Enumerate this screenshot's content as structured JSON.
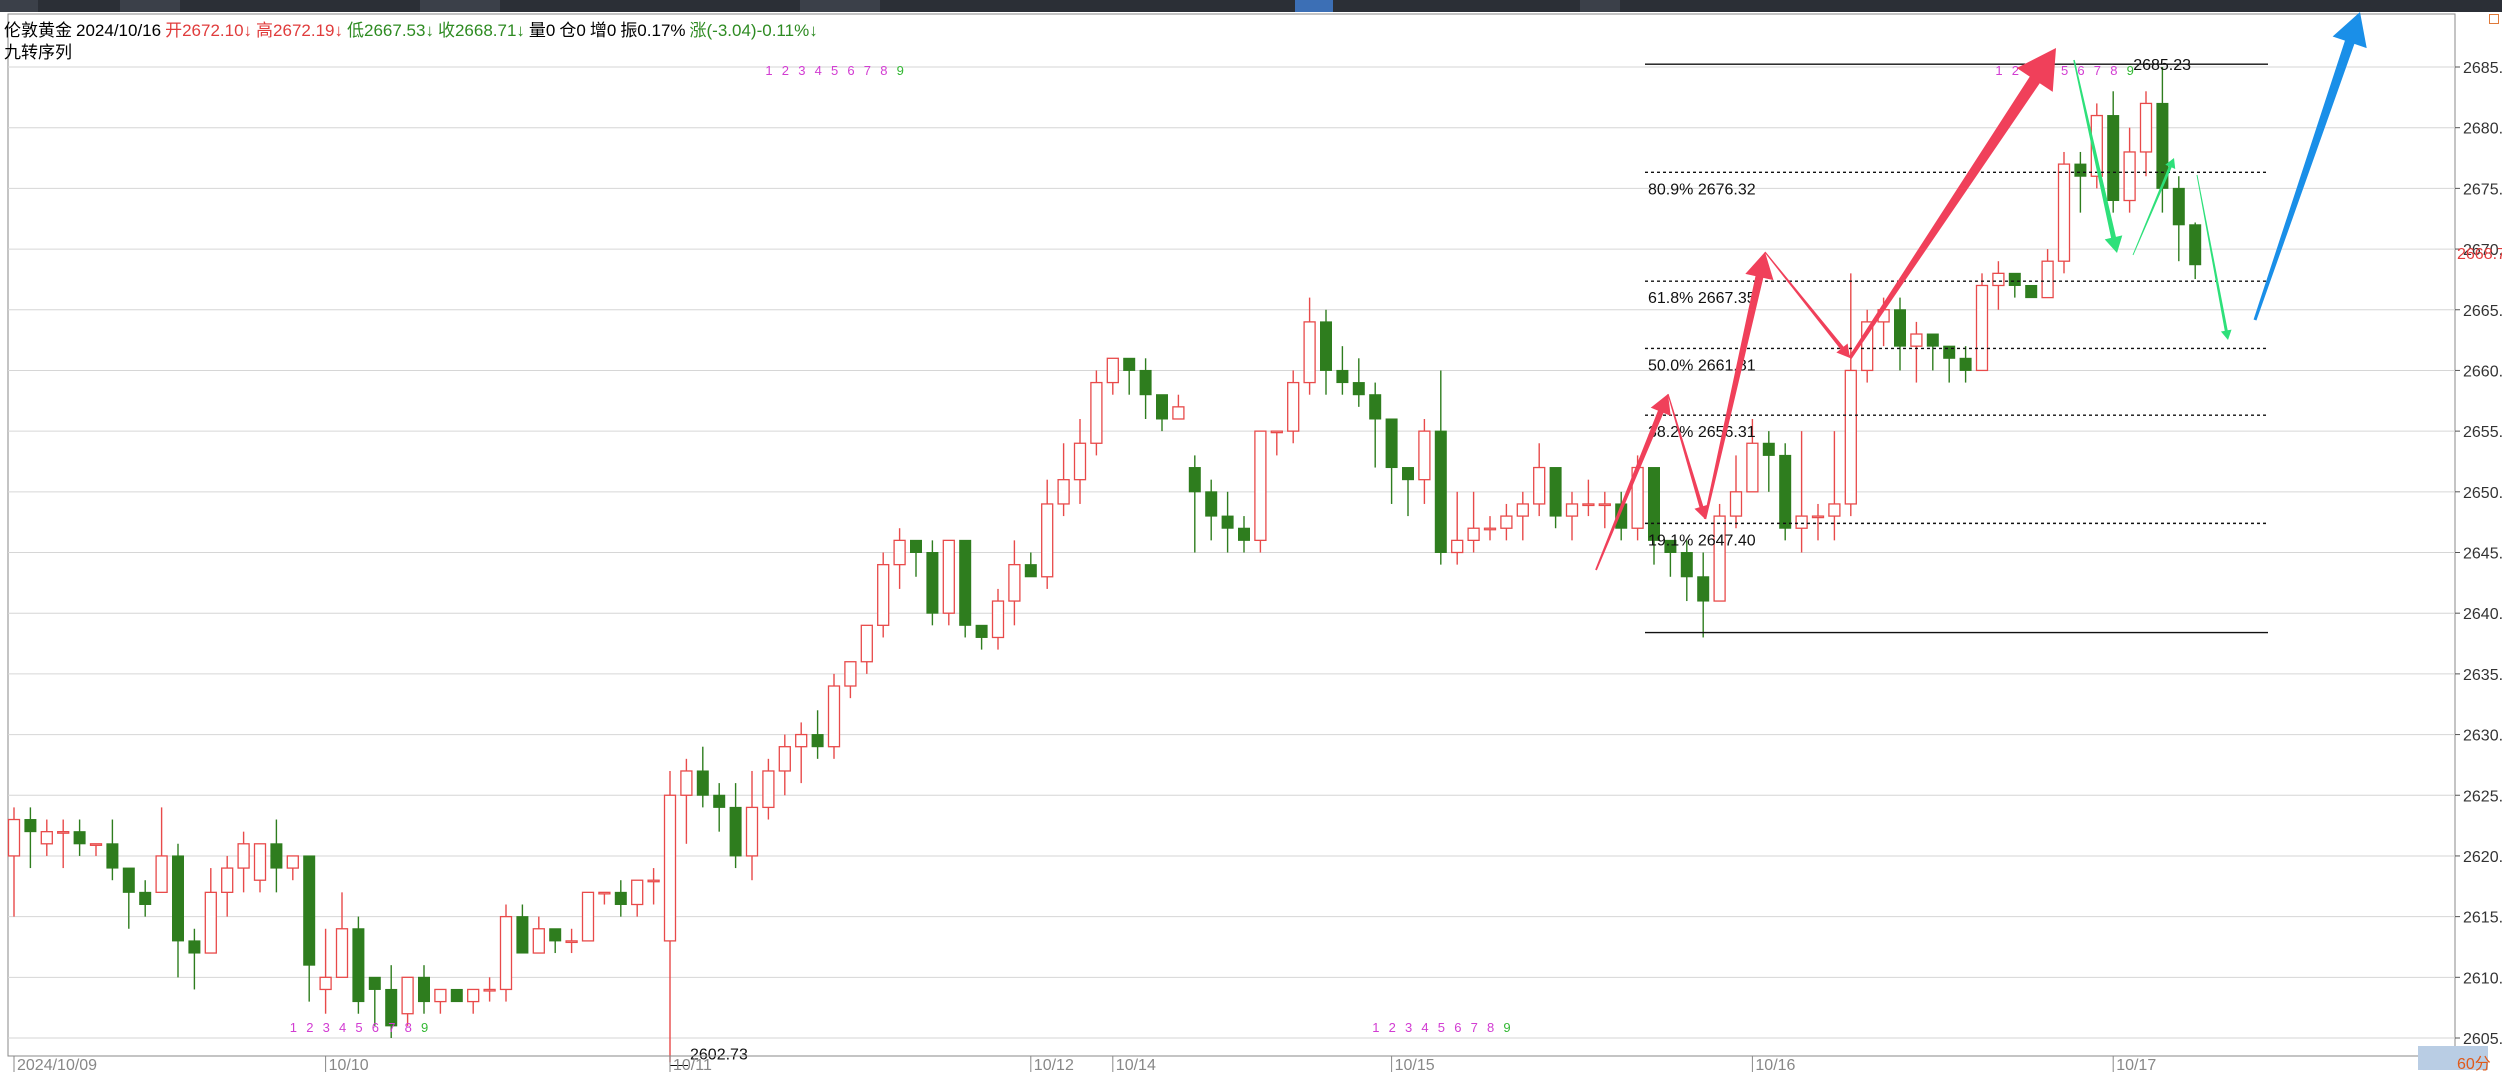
{
  "header": {
    "symbol": "伦敦黄金",
    "date": "2024/10/16",
    "open_label": "开2672.10↓",
    "high_label": "高2672.19↓",
    "low_label": "低2667.53↓",
    "close_label": "收2668.71↓",
    "volume_label": "量0",
    "position_label": "仓0",
    "increment_label": "增0",
    "amplitude_label": "振0.17%",
    "change_label": "涨(-3.04)-0.11%↓",
    "indicator_name": "九转序列"
  },
  "colors": {
    "up": "#e84a4a",
    "down": "#2e7d1e",
    "arrow_red": "#f0405a",
    "arrow_green": "#2ee07a",
    "arrow_blue": "#1a8fe8",
    "grid": "#d6d6d6",
    "magenta": "#d23cd2",
    "green_label": "#33b833",
    "price_tag": "#e03c3c"
  },
  "price_tag": "2668.7",
  "period": "60分",
  "chart_data": {
    "type": "candlestick",
    "title": "",
    "xlabel": "",
    "ylabel": "",
    "ylim": [
      2602,
      2689
    ],
    "grid": true,
    "y_ticks": [
      2605,
      2610,
      2615,
      2620,
      2625,
      2630,
      2635,
      2640,
      2645,
      2650,
      2655,
      2660,
      2665,
      2670,
      2675,
      2680,
      2685
    ],
    "y_tick_labels": [
      "2605.0",
      "2610.0",
      "2615.0",
      "2620.0",
      "2625.0",
      "2630.0",
      "2635.0",
      "2640.0",
      "2645.0",
      "2650.0",
      "2655.0",
      "2660.0",
      "2665.0",
      "2670.0",
      "2675.0",
      "2680.0",
      "2685.0"
    ],
    "x_labels": [
      {
        "index": 0,
        "label": "2024/10/09"
      },
      {
        "index": 19,
        "label": "10/10"
      },
      {
        "index": 40,
        "label": "10/11"
      },
      {
        "index": 62,
        "label": "10/12"
      },
      {
        "index": 67,
        "label": "10/14"
      },
      {
        "index": 84,
        "label": "10/15"
      },
      {
        "index": 106,
        "label": "10/16"
      },
      {
        "index": 128,
        "label": "10/17"
      }
    ],
    "candles": [
      [
        2620,
        2623,
        2615,
        2624
      ],
      [
        2623,
        2622,
        2619,
        2624
      ],
      [
        2621,
        2622,
        2620,
        2623
      ],
      [
        2622,
        2622,
        2619,
        2623
      ],
      [
        2622,
        2621,
        2620,
        2623
      ],
      [
        2621,
        2621,
        2620,
        2621
      ],
      [
        2621,
        2619,
        2618,
        2623
      ],
      [
        2619,
        2617,
        2614,
        2619
      ],
      [
        2617,
        2616,
        2615,
        2618
      ],
      [
        2617,
        2620,
        2617,
        2624
      ],
      [
        2620,
        2613,
        2610,
        2621
      ],
      [
        2613,
        2612,
        2609,
        2614
      ],
      [
        2612,
        2617,
        2612,
        2619
      ],
      [
        2617,
        2619,
        2615,
        2620
      ],
      [
        2619,
        2621,
        2617,
        2622
      ],
      [
        2618,
        2621,
        2617,
        2621
      ],
      [
        2621,
        2619,
        2617,
        2623
      ],
      [
        2619,
        2620,
        2618,
        2620
      ],
      [
        2620,
        2611,
        2608,
        2620
      ],
      [
        2609,
        2610,
        2607,
        2614
      ],
      [
        2610,
        2614,
        2610,
        2617
      ],
      [
        2614,
        2608,
        2607,
        2615
      ],
      [
        2610,
        2609,
        2606,
        2610
      ],
      [
        2609,
        2606,
        2605,
        2611
      ],
      [
        2607,
        2610,
        2606,
        2610
      ],
      [
        2610,
        2608,
        2607,
        2611
      ],
      [
        2608,
        2609,
        2607,
        2609
      ],
      [
        2609,
        2608,
        2608,
        2609
      ],
      [
        2608,
        2609,
        2607,
        2609
      ],
      [
        2609,
        2609,
        2608,
        2610
      ],
      [
        2609,
        2615,
        2608,
        2616
      ],
      [
        2615,
        2612,
        2612,
        2616
      ],
      [
        2612,
        2614,
        2612,
        2615
      ],
      [
        2614,
        2613,
        2612,
        2614
      ],
      [
        2613,
        2613,
        2612,
        2614
      ],
      [
        2613,
        2617,
        2613,
        2617
      ],
      [
        2617,
        2617,
        2616,
        2617
      ],
      [
        2617,
        2616,
        2615,
        2618
      ],
      [
        2616,
        2618,
        2615,
        2618
      ],
      [
        2618,
        2618,
        2616,
        2619
      ],
      [
        2613,
        2625,
        2603,
        2627
      ],
      [
        2625,
        2627,
        2621,
        2628
      ],
      [
        2627,
        2625,
        2624,
        2629
      ],
      [
        2625,
        2624,
        2622,
        2626
      ],
      [
        2624,
        2620,
        2619,
        2626
      ],
      [
        2620,
        2624,
        2618,
        2627
      ],
      [
        2624,
        2627,
        2623,
        2628
      ],
      [
        2627,
        2629,
        2625,
        2630
      ],
      [
        2629,
        2630,
        2626,
        2631
      ],
      [
        2630,
        2629,
        2628,
        2632
      ],
      [
        2629,
        2634,
        2628,
        2635
      ],
      [
        2634,
        2636,
        2633,
        2636
      ],
      [
        2636,
        2639,
        2635,
        2639
      ],
      [
        2639,
        2644,
        2638,
        2645
      ],
      [
        2644,
        2646,
        2642,
        2647
      ],
      [
        2646,
        2645,
        2643,
        2646
      ],
      [
        2645,
        2640,
        2639,
        2646
      ],
      [
        2640,
        2646,
        2639,
        2646
      ],
      [
        2646,
        2639,
        2638,
        2646
      ],
      [
        2639,
        2638,
        2637,
        2639
      ],
      [
        2638,
        2641,
        2637,
        2642
      ],
      [
        2641,
        2644,
        2639,
        2646
      ],
      [
        2644,
        2643,
        2643,
        2645
      ],
      [
        2643,
        2649,
        2642,
        2651
      ],
      [
        2649,
        2651,
        2648,
        2654
      ],
      [
        2651,
        2654,
        2649,
        2656
      ],
      [
        2654,
        2659,
        2653,
        2660
      ],
      [
        2659,
        2661,
        2658,
        2661
      ],
      [
        2661,
        2660,
        2658,
        2661
      ],
      [
        2660,
        2658,
        2656,
        2661
      ],
      [
        2658,
        2656,
        2655,
        2658
      ],
      [
        2656,
        2657,
        2656,
        2658
      ],
      [
        2652,
        2650,
        2645,
        2653
      ],
      [
        2650,
        2648,
        2646,
        2651
      ],
      [
        2648,
        2647,
        2645,
        2650
      ],
      [
        2647,
        2646,
        2645,
        2648
      ],
      [
        2646,
        2655,
        2645,
        2655
      ],
      [
        2655,
        2655,
        2653,
        2655
      ],
      [
        2655,
        2659,
        2654,
        2660
      ],
      [
        2659,
        2664,
        2658,
        2666
      ],
      [
        2664,
        2660,
        2658,
        2665
      ],
      [
        2660,
        2659,
        2658,
        2662
      ],
      [
        2659,
        2658,
        2657,
        2661
      ],
      [
        2658,
        2656,
        2652,
        2659
      ],
      [
        2656,
        2652,
        2649,
        2656
      ],
      [
        2652,
        2651,
        2648,
        2652
      ],
      [
        2651,
        2655,
        2649,
        2656
      ],
      [
        2655,
        2645,
        2644,
        2660
      ],
      [
        2645,
        2646,
        2644,
        2650
      ],
      [
        2646,
        2647,
        2645,
        2650
      ],
      [
        2647,
        2647,
        2646,
        2648
      ],
      [
        2647,
        2648,
        2646,
        2649
      ],
      [
        2648,
        2649,
        2646,
        2650
      ],
      [
        2649,
        2652,
        2648,
        2654
      ],
      [
        2652,
        2648,
        2647,
        2652
      ],
      [
        2648,
        2649,
        2646,
        2650
      ],
      [
        2649,
        2649,
        2648,
        2651
      ],
      [
        2649,
        2649,
        2647,
        2650
      ],
      [
        2649,
        2647,
        2646,
        2650
      ],
      [
        2647,
        2652,
        2646,
        2653
      ],
      [
        2652,
        2646,
        2644,
        2652
      ],
      [
        2646,
        2645,
        2643,
        2646
      ],
      [
        2645,
        2643,
        2641,
        2646
      ],
      [
        2643,
        2641,
        2638,
        2645
      ],
      [
        2641,
        2648,
        2641,
        2649
      ],
      [
        2648,
        2650,
        2647,
        2653
      ],
      [
        2650,
        2654,
        2650,
        2656
      ],
      [
        2654,
        2653,
        2650,
        2655
      ],
      [
        2653,
        2647,
        2646,
        2654
      ],
      [
        2647,
        2648,
        2645,
        2655
      ],
      [
        2648,
        2648,
        2646,
        2649
      ],
      [
        2648,
        2649,
        2646,
        2655
      ],
      [
        2649,
        2660,
        2648,
        2668
      ],
      [
        2660,
        2664,
        2659,
        2665
      ],
      [
        2664,
        2665,
        2662,
        2666
      ],
      [
        2665,
        2662,
        2660,
        2666
      ],
      [
        2662,
        2663,
        2659,
        2664
      ],
      [
        2663,
        2662,
        2660,
        2663
      ],
      [
        2662,
        2661,
        2659,
        2662
      ],
      [
        2661,
        2660,
        2659,
        2662
      ],
      [
        2660,
        2667,
        2660,
        2668
      ],
      [
        2667,
        2668,
        2665,
        2669
      ],
      [
        2668,
        2667,
        2666,
        2668
      ],
      [
        2667,
        2666,
        2666,
        2667
      ],
      [
        2666,
        2669,
        2666,
        2670
      ],
      [
        2669,
        2677,
        2668,
        2678
      ],
      [
        2677,
        2676,
        2673,
        2678
      ],
      [
        2676,
        2681,
        2675,
        2682
      ],
      [
        2681,
        2674,
        2673,
        2683
      ],
      [
        2674,
        2678,
        2673,
        2680
      ],
      [
        2678,
        2682,
        2676,
        2683
      ],
      [
        2682,
        2675,
        2673,
        2685
      ],
      [
        2675,
        2672,
        2669,
        2676
      ],
      [
        2672,
        2668.71,
        2667.53,
        2672.19
      ]
    ],
    "annotations": [
      {
        "type": "line",
        "label": "",
        "value": 2685.23
      },
      {
        "type": "line",
        "label": "80.9% 2676.32",
        "value": 2676.32
      },
      {
        "type": "line",
        "label": "61.8% 2667.35",
        "value": 2667.35
      },
      {
        "type": "line",
        "label": "50.0% 2661.81",
        "value": 2661.81
      },
      {
        "type": "line",
        "label": "38.2% 2656.31",
        "value": 2656.31
      },
      {
        "type": "line",
        "label": "19.1% 2647.40",
        "value": 2647.4
      },
      {
        "type": "line",
        "label": "",
        "value": 2638.4
      },
      {
        "type": "price_label",
        "label": "2685.23",
        "index": 128,
        "value": 2685.23
      },
      {
        "type": "price_label",
        "label": "2602.73",
        "index": 40,
        "value": 2602.73
      }
    ],
    "td_sequences": [
      {
        "start_index": 17,
        "numbers": [
          "1",
          "2",
          "3",
          "4",
          "5",
          "6",
          "7",
          "8",
          "9"
        ],
        "position": "bottom"
      },
      {
        "start_index": 46,
        "numbers": [
          "1",
          "2",
          "3",
          "4",
          "5",
          "6",
          "7",
          "8",
          "9"
        ],
        "position": "top"
      },
      {
        "start_index": 83,
        "numbers": [
          "1",
          "2",
          "3",
          "4",
          "5",
          "6",
          "7",
          "8",
          "9"
        ],
        "position": "bottom"
      },
      {
        "start_index": 121,
        "numbers": [
          "1",
          "2",
          "3",
          "4",
          "5",
          "6",
          "7",
          "8",
          "9"
        ],
        "position": "top"
      }
    ]
  }
}
